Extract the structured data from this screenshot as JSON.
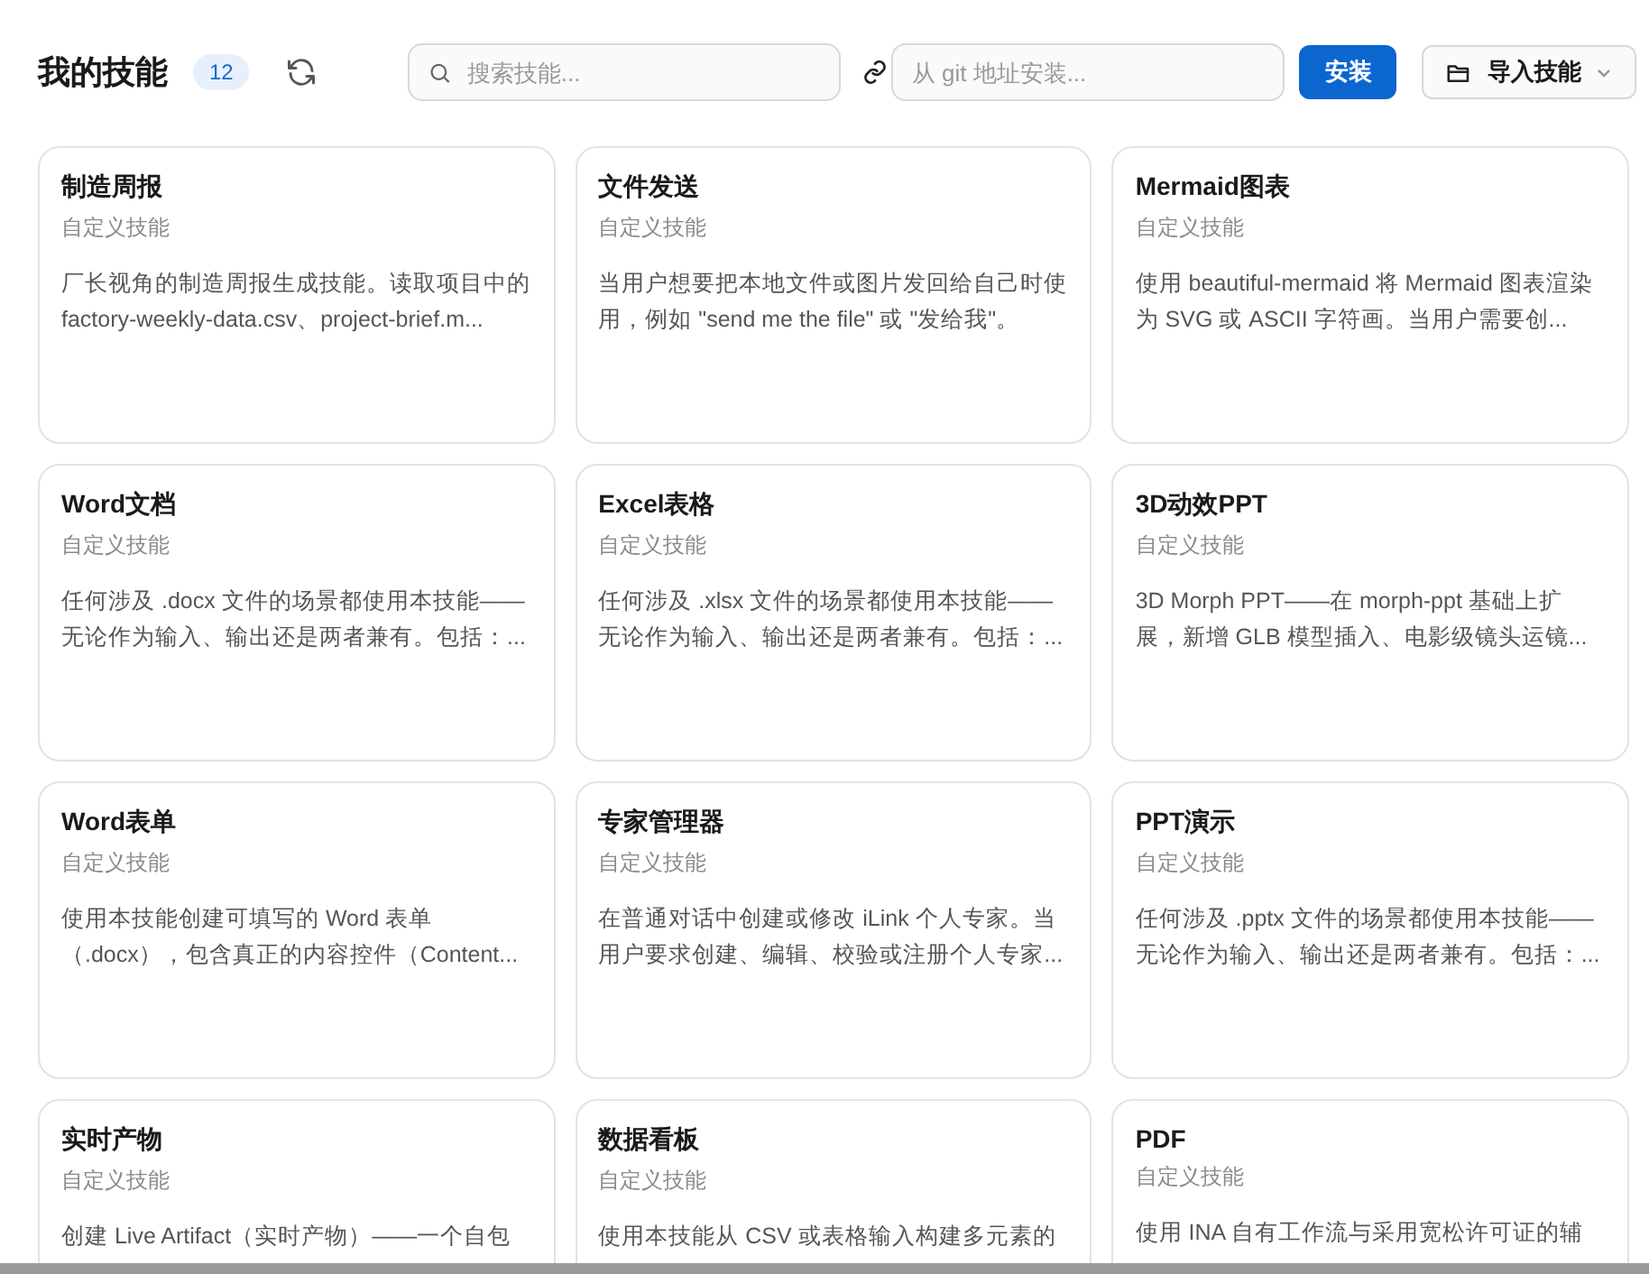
{
  "header": {
    "title": "我的技能",
    "count": "12",
    "search": {
      "placeholder": "搜索技能..."
    },
    "git_input": {
      "placeholder": "从 git 地址安装..."
    },
    "install_button": "安装",
    "import_button": "导入技能"
  },
  "skills": [
    {
      "name": "制造周报",
      "type": "自定义技能",
      "description": "厂长视角的制造周报生成技能。读取项目中的 factory-weekly-data.csv、project-brief.m..."
    },
    {
      "name": "文件发送",
      "type": "自定义技能",
      "description": "当用户想要把本地文件或图片发回给自己时使用，例如 \"send me the file\" 或 \"发给我\"。"
    },
    {
      "name": "Mermaid图表",
      "type": "自定义技能",
      "description": "使用 beautiful-mermaid 将 Mermaid 图表渲染为 SVG 或 ASCII 字符画。当用户需要创..."
    },
    {
      "name": "Word文档",
      "type": "自定义技能",
      "description": "任何涉及 .docx 文件的场景都使用本技能——无论作为输入、输出还是两者兼有。包括：..."
    },
    {
      "name": "Excel表格",
      "type": "自定义技能",
      "description": "任何涉及 .xlsx 文件的场景都使用本技能——无论作为输入、输出还是两者兼有。包括：..."
    },
    {
      "name": "3D动效PPT",
      "type": "自定义技能",
      "description": "3D Morph PPT——在 morph-ppt 基础上扩展，新增 GLB 模型插入、电影级镜头运镜..."
    },
    {
      "name": "Word表单",
      "type": "自定义技能",
      "description": "使用本技能创建可填写的 Word 表单（.docx），包含真正的内容控件（Content..."
    },
    {
      "name": "专家管理器",
      "type": "自定义技能",
      "description": "在普通对话中创建或修改 iLink 个人专家。当用户要求创建、编辑、校验或注册个人专家..."
    },
    {
      "name": "PPT演示",
      "type": "自定义技能",
      "description": "任何涉及 .pptx 文件的场景都使用本技能——无论作为输入、输出还是两者兼有。包括：..."
    },
    {
      "name": "实时产物",
      "type": "自定义技能",
      "description": "创建 Live Artifact（实时产物）——一个自包"
    },
    {
      "name": "数据看板",
      "type": "自定义技能",
      "description": "使用本技能从 CSV 或表格输入构建多元素的"
    },
    {
      "name": "PDF",
      "type": "自定义技能",
      "description": "使用 INA 自有工作流与采用宽松许可证的辅"
    }
  ]
}
